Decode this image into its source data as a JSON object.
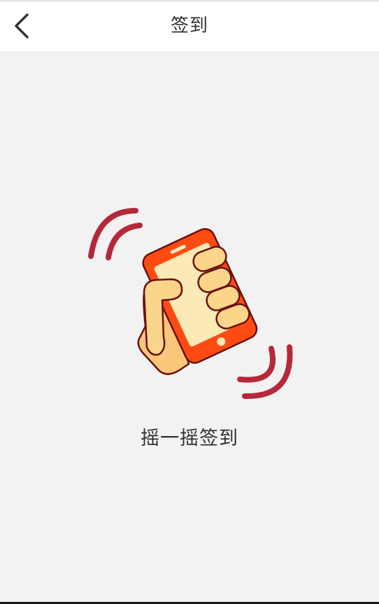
{
  "header": {
    "title": "签到",
    "back_icon": "chevron-left-icon"
  },
  "main": {
    "illustration_icon": "hand-shaking-phone-icon",
    "caption": "摇一摇签到"
  },
  "colors": {
    "background": "#f2f2f2",
    "app_bar": "#ffffff",
    "phone": "#ff4a12",
    "screen": "#fbeab6",
    "hand": "#fbd58a",
    "waves": "#b5283a"
  }
}
